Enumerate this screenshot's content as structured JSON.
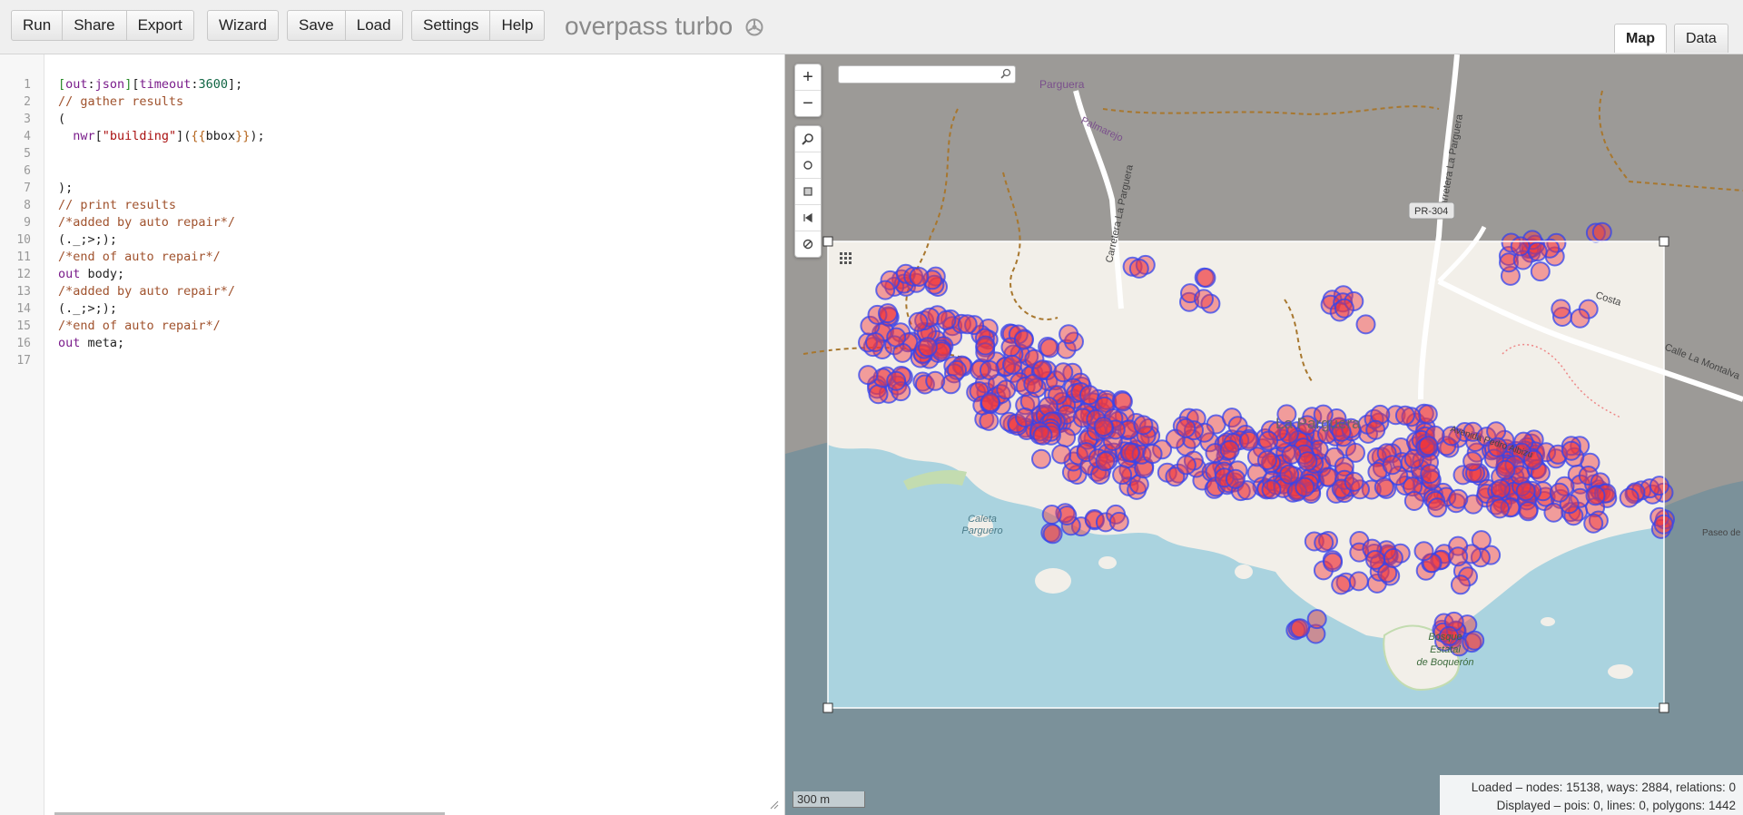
{
  "toolbar": {
    "run": "Run",
    "share": "Share",
    "export": "Export",
    "wizard": "Wizard",
    "save": "Save",
    "load": "Load",
    "settings": "Settings",
    "help": "Help",
    "brand": "overpass turbo"
  },
  "tabs": {
    "map": "Map",
    "data": "Data"
  },
  "editor": {
    "lines": [
      "[out:json][timeout:3600];",
      "// gather results",
      "(",
      "  nwr[\"building\"]({{bbox}});",
      "",
      "",
      ");",
      "// print results",
      "/*added by auto repair*/",
      "(._;>;);",
      "/*end of auto repair*/",
      "out body;",
      "/*added by auto repair*/",
      "(._;>;);",
      "/*end of auto repair*/",
      "out meta;",
      ""
    ]
  },
  "map": {
    "search_placeholder": "",
    "scale": "300 m",
    "labels": {
      "parguera": "Parguera",
      "palmarejo": "Palmarejo",
      "carretera1": "Carretera La Parguera",
      "carretera2": "Carretera La Parguera",
      "pr304": "PR-304",
      "costa": "Costa",
      "calle_montalva": "Calle La Montalva",
      "la_parguera": "La Parguera",
      "avenida": "Avenida Pedro Albizu",
      "caleta1": "Caleta",
      "caleta2": "Parguero",
      "paseo": "Paseo de Los",
      "bosque1": "Bosque",
      "bosque2": "Estatal",
      "bosque3": "de Boquerón"
    }
  },
  "stats": {
    "loaded": "Loaded – nodes: 15138, ways: 2884, relations: 0",
    "displayed": "Displayed – pois: 0, lines: 0, polygons: 1442"
  },
  "colors": {
    "marker_fill": "#f0383c",
    "marker_stroke": "#3344ee",
    "sea": "#aad3df",
    "land": "#f2efe9",
    "mask": "#7f7f7f"
  }
}
